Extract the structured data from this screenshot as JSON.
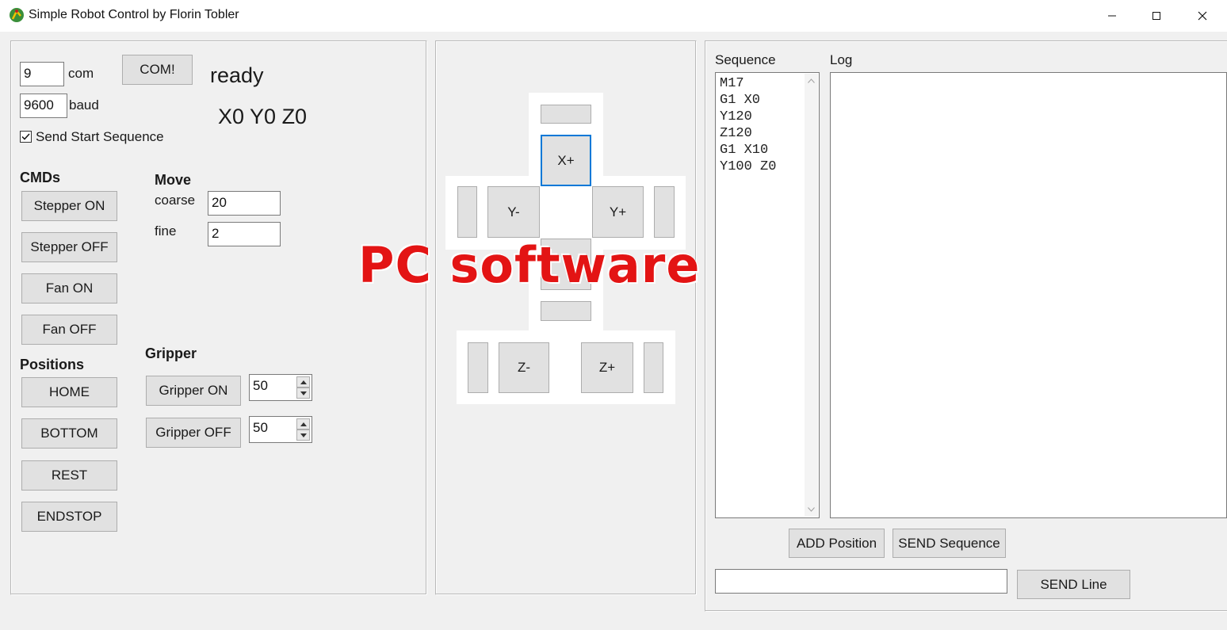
{
  "window": {
    "title": "Simple Robot Control by Florin Tobler",
    "minimize": "—",
    "maximize": "☐",
    "close": "✕",
    "icon": "robot-arm-icon"
  },
  "connection": {
    "com_value": "9",
    "com_label": "com",
    "baud_value": "9600",
    "baud_label": "baud",
    "com_button": "COM!",
    "status": "ready",
    "position_readout": "X0 Y0 Z0",
    "send_start_sequence_label": "Send Start Sequence",
    "send_start_sequence_checked": true
  },
  "cmds": {
    "heading": "CMDs",
    "buttons": [
      "Stepper ON",
      "Stepper OFF",
      "Fan ON",
      "Fan OFF"
    ]
  },
  "move": {
    "heading": "Move",
    "coarse_label": "coarse",
    "coarse_value": "20",
    "fine_label": "fine",
    "fine_value": "2"
  },
  "positions": {
    "heading": "Positions",
    "buttons": [
      "HOME",
      "BOTTOM",
      "REST",
      "ENDSTOP"
    ]
  },
  "gripper": {
    "heading": "Gripper",
    "on_label": "Gripper ON",
    "on_value": "50",
    "off_label": "Gripper OFF",
    "off_value": "50"
  },
  "jog": {
    "x_plus": "X+",
    "y_minus": "Y-",
    "y_plus": "Y+",
    "z_minus": "Z-",
    "z_plus": "Z+"
  },
  "sequence": {
    "label": "Sequence",
    "lines": [
      "M17",
      "G1 X0",
      "Y120",
      "Z120",
      "G1 X10",
      "Y100 Z0"
    ]
  },
  "log": {
    "label": "Log"
  },
  "actions": {
    "add_position": "ADD Position",
    "send_sequence": "SEND Sequence",
    "send_line": "SEND Line",
    "line_input_value": ""
  },
  "overlay": {
    "watermark": "PC software",
    "color": "#e31414"
  },
  "colors": {
    "focus_accent": "#0078d7",
    "window_bg": "#f0f0f0"
  }
}
